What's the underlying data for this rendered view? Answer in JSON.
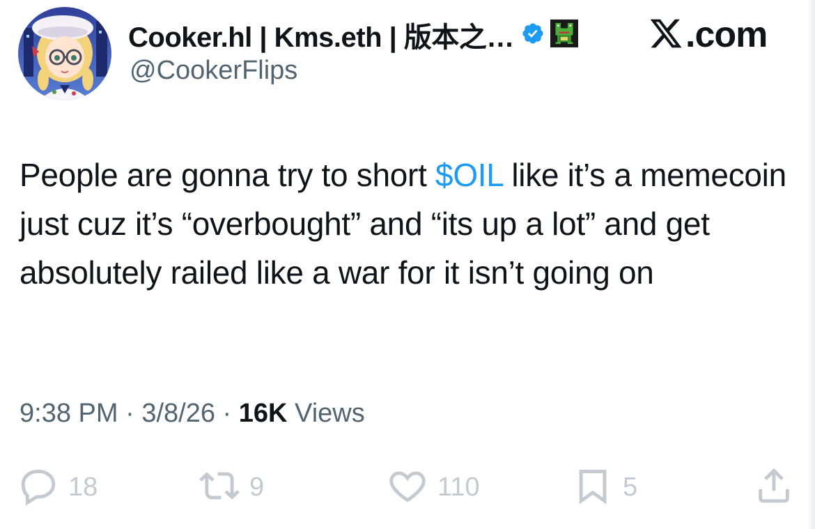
{
  "header": {
    "display_name": "Cooker.hl | Kms.eth | 版本之…",
    "handle": "@CookerFlips",
    "verified": true,
    "badge_icon": "frog-pixel-icon",
    "avatar_icon": "anime-avatar"
  },
  "site": {
    "logo_icon": "x-logo-icon",
    "domain": ".com"
  },
  "tweet": {
    "text_before": "People are gonna try to short ",
    "cashtag": "$OIL",
    "text_after": " like it’s a memecoin just cuz it’s “overbought” and “its up a lot” and get absolutely railed like a war for it isn’t going on"
  },
  "meta": {
    "time": "9:38 PM",
    "separator": "·",
    "date": "3/8/26",
    "views_count": "16K",
    "views_label": "Views"
  },
  "actions": {
    "replies": "18",
    "reposts": "9",
    "likes": "110",
    "bookmarks": "5"
  },
  "colors": {
    "text": "#0f1419",
    "muted": "#536471",
    "accent": "#1d9bf0",
    "action_gray": "#bfc6cc"
  }
}
